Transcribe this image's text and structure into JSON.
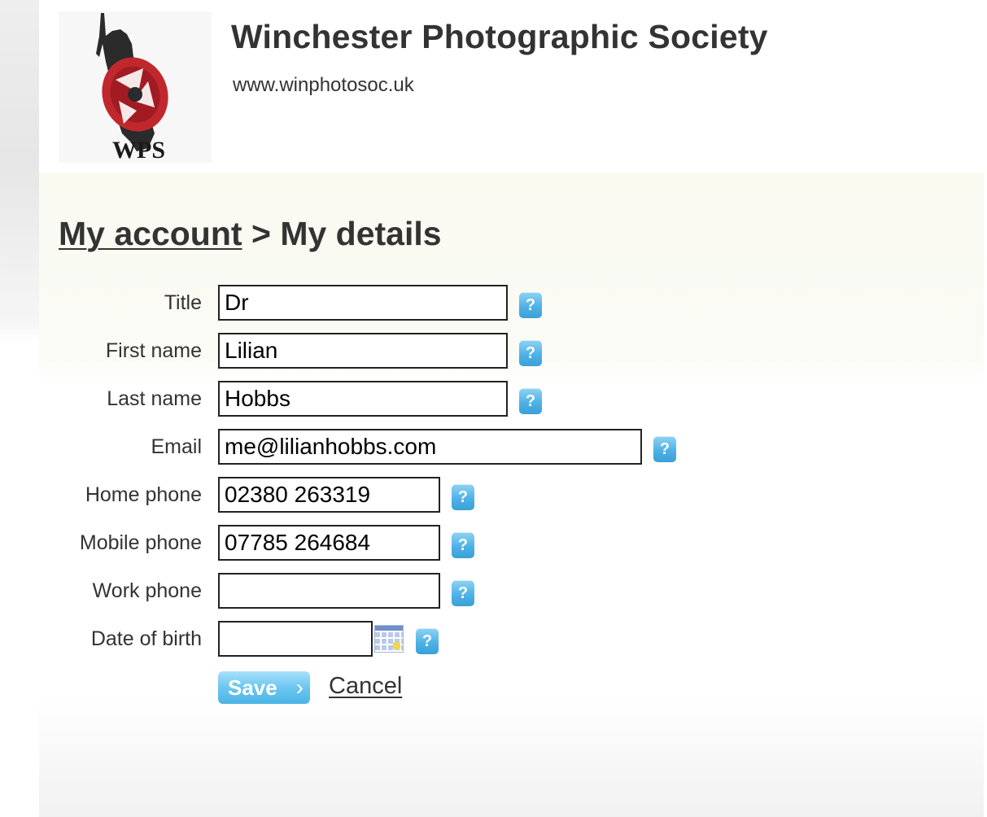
{
  "header": {
    "logo_text": "WPS",
    "title": "Winchester Photographic Society",
    "url": "www.winphotosoc.uk"
  },
  "breadcrumb": {
    "link_label": "My account",
    "separator": ">",
    "current": "My details"
  },
  "form": {
    "fields": [
      {
        "label": "Title",
        "value": "Dr"
      },
      {
        "label": "First name",
        "value": "Lilian"
      },
      {
        "label": "Last name",
        "value": "Hobbs"
      },
      {
        "label": "Email",
        "value": "me@lilianhobbs.com"
      },
      {
        "label": "Home phone",
        "value": "02380 263319"
      },
      {
        "label": "Mobile phone",
        "value": "07785 264684"
      },
      {
        "label": "Work phone",
        "value": ""
      },
      {
        "label": "Date of birth",
        "value": ""
      }
    ],
    "help_glyph": "?",
    "save_label": "Save",
    "save_chevron": "›",
    "cancel_label": "Cancel"
  },
  "colors": {
    "help_icon": "#4fb2e6",
    "save_button": "#6cc6f0",
    "text": "#333333"
  }
}
